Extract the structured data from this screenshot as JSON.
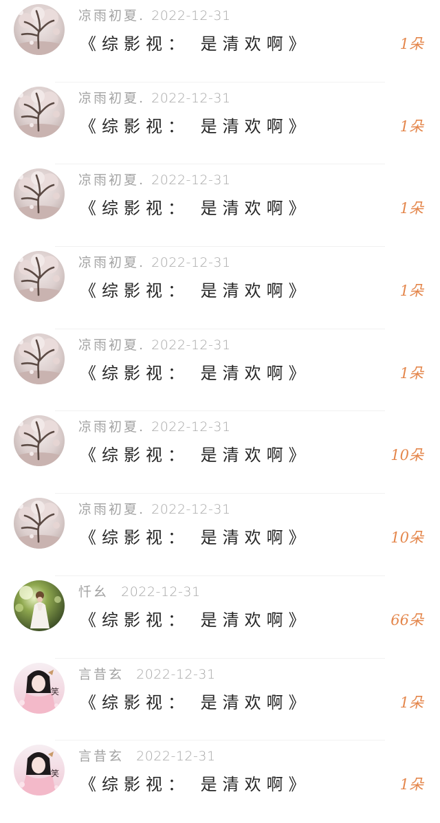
{
  "colors": {
    "name_date": "#a3a3a3",
    "message": "#262626",
    "gift_count": "#e4864b",
    "divider": "#f1f1f1"
  },
  "feed": [
    {
      "avatar_icon": "tree-avatar-icon",
      "user": "凉雨初夏",
      "sep": ".",
      "date": "2022-12-31",
      "message": "《综影视： 是清欢啊》",
      "gift": "1朵"
    },
    {
      "avatar_icon": "tree-avatar-icon",
      "user": "凉雨初夏",
      "sep": ".",
      "date": "2022-12-31",
      "message": "《综影视： 是清欢啊》",
      "gift": "1朵"
    },
    {
      "avatar_icon": "tree-avatar-icon",
      "user": "凉雨初夏",
      "sep": ".",
      "date": "2022-12-31",
      "message": "《综影视： 是清欢啊》",
      "gift": "1朵"
    },
    {
      "avatar_icon": "tree-avatar-icon",
      "user": "凉雨初夏",
      "sep": ".",
      "date": "2022-12-31",
      "message": "《综影视： 是清欢啊》",
      "gift": "1朵"
    },
    {
      "avatar_icon": "tree-avatar-icon",
      "user": "凉雨初夏",
      "sep": ".",
      "date": "2022-12-31",
      "message": "《综影视： 是清欢啊》",
      "gift": "1朵"
    },
    {
      "avatar_icon": "tree-avatar-icon",
      "user": "凉雨初夏",
      "sep": ".",
      "date": "2022-12-31",
      "message": "《综影视： 是清欢啊》",
      "gift": "10朵"
    },
    {
      "avatar_icon": "tree-avatar-icon",
      "user": "凉雨初夏",
      "sep": ".",
      "date": "2022-12-31",
      "message": "《综影视： 是清欢啊》",
      "gift": "10朵"
    },
    {
      "avatar_icon": "forest-girl-avatar-icon",
      "user": "忏幺",
      "sep": "",
      "date": "2022-12-31",
      "message": "《综影视： 是清欢啊》",
      "gift": "66朵"
    },
    {
      "avatar_icon": "pink-lady-avatar-icon",
      "user": "言昔玄",
      "sep": "",
      "date": "2022-12-31",
      "message": "《综影视： 是清欢啊》",
      "gift": "1朵"
    },
    {
      "avatar_icon": "pink-lady-avatar-icon",
      "user": "言昔玄",
      "sep": "",
      "date": "2022-12-31",
      "message": "《综影视： 是清欢啊》",
      "gift": "1朵"
    }
  ]
}
